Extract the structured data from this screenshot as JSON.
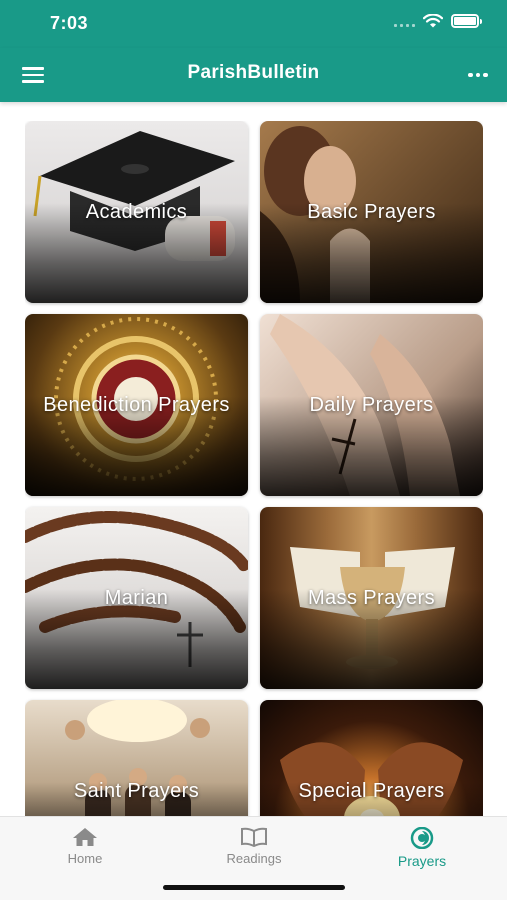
{
  "status_bar": {
    "time": "7:03"
  },
  "app_bar": {
    "title": "ParishBulletin",
    "menu_icon": "hamburger-menu-icon",
    "more_icon": "more-horizontal-icon"
  },
  "categories": [
    {
      "label": "Academics",
      "image": "graduation-cap-diploma"
    },
    {
      "label": "Basic Prayers",
      "image": "woman-praying"
    },
    {
      "label": "Benediction Prayers",
      "image": "golden-monstrance"
    },
    {
      "label": "Daily Prayers",
      "image": "praying-hands-rosary"
    },
    {
      "label": "Marian",
      "image": "rosary-beads"
    },
    {
      "label": "Mass Prayers",
      "image": "chalice-altar"
    },
    {
      "label": "Saint Prayers",
      "image": "saints-painting"
    },
    {
      "label": "Special Prayers",
      "image": "hands-candle"
    }
  ],
  "tabs": [
    {
      "label": "Home",
      "icon": "home-icon",
      "active": false
    },
    {
      "label": "Readings",
      "icon": "book-icon",
      "active": false
    },
    {
      "label": "Prayers",
      "icon": "prayers-icon",
      "active": true
    }
  ],
  "colors": {
    "primary": "#199a88",
    "tab_inactive": "#8a8a8a",
    "background": "#ffffff"
  }
}
